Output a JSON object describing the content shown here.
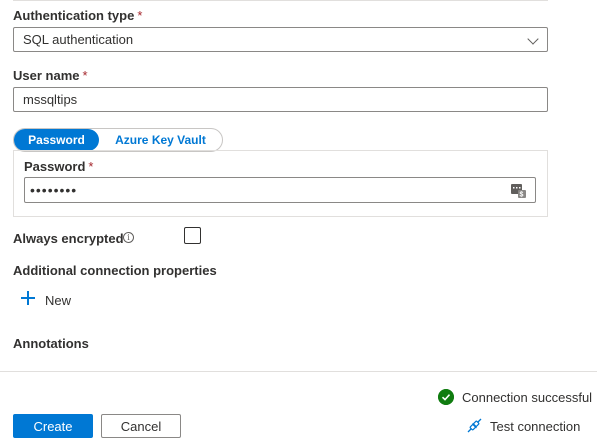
{
  "auth": {
    "label": "Authentication type",
    "required_mark": "*",
    "value": "SQL authentication"
  },
  "username": {
    "label": "User name",
    "required_mark": "*",
    "value": "mssqltips"
  },
  "password_toggle": {
    "active": "Password",
    "inactive": "Azure Key Vault"
  },
  "password": {
    "label": "Password",
    "required_mark": "*",
    "masked_value": "••••••••",
    "key_icon": "key-vault-icon"
  },
  "always_encrypted": {
    "label": "Always encrypted",
    "info_icon": "info-icon",
    "checked": false
  },
  "additional_props": {
    "label": "Additional connection properties",
    "new_label": "New"
  },
  "annotations": {
    "label": "Annotations"
  },
  "status": {
    "text": "Connection successful",
    "color": "#107c10"
  },
  "actions": {
    "create": "Create",
    "cancel": "Cancel",
    "test": "Test connection"
  },
  "colors": {
    "accent": "#0078d4",
    "required": "#a4262c"
  }
}
